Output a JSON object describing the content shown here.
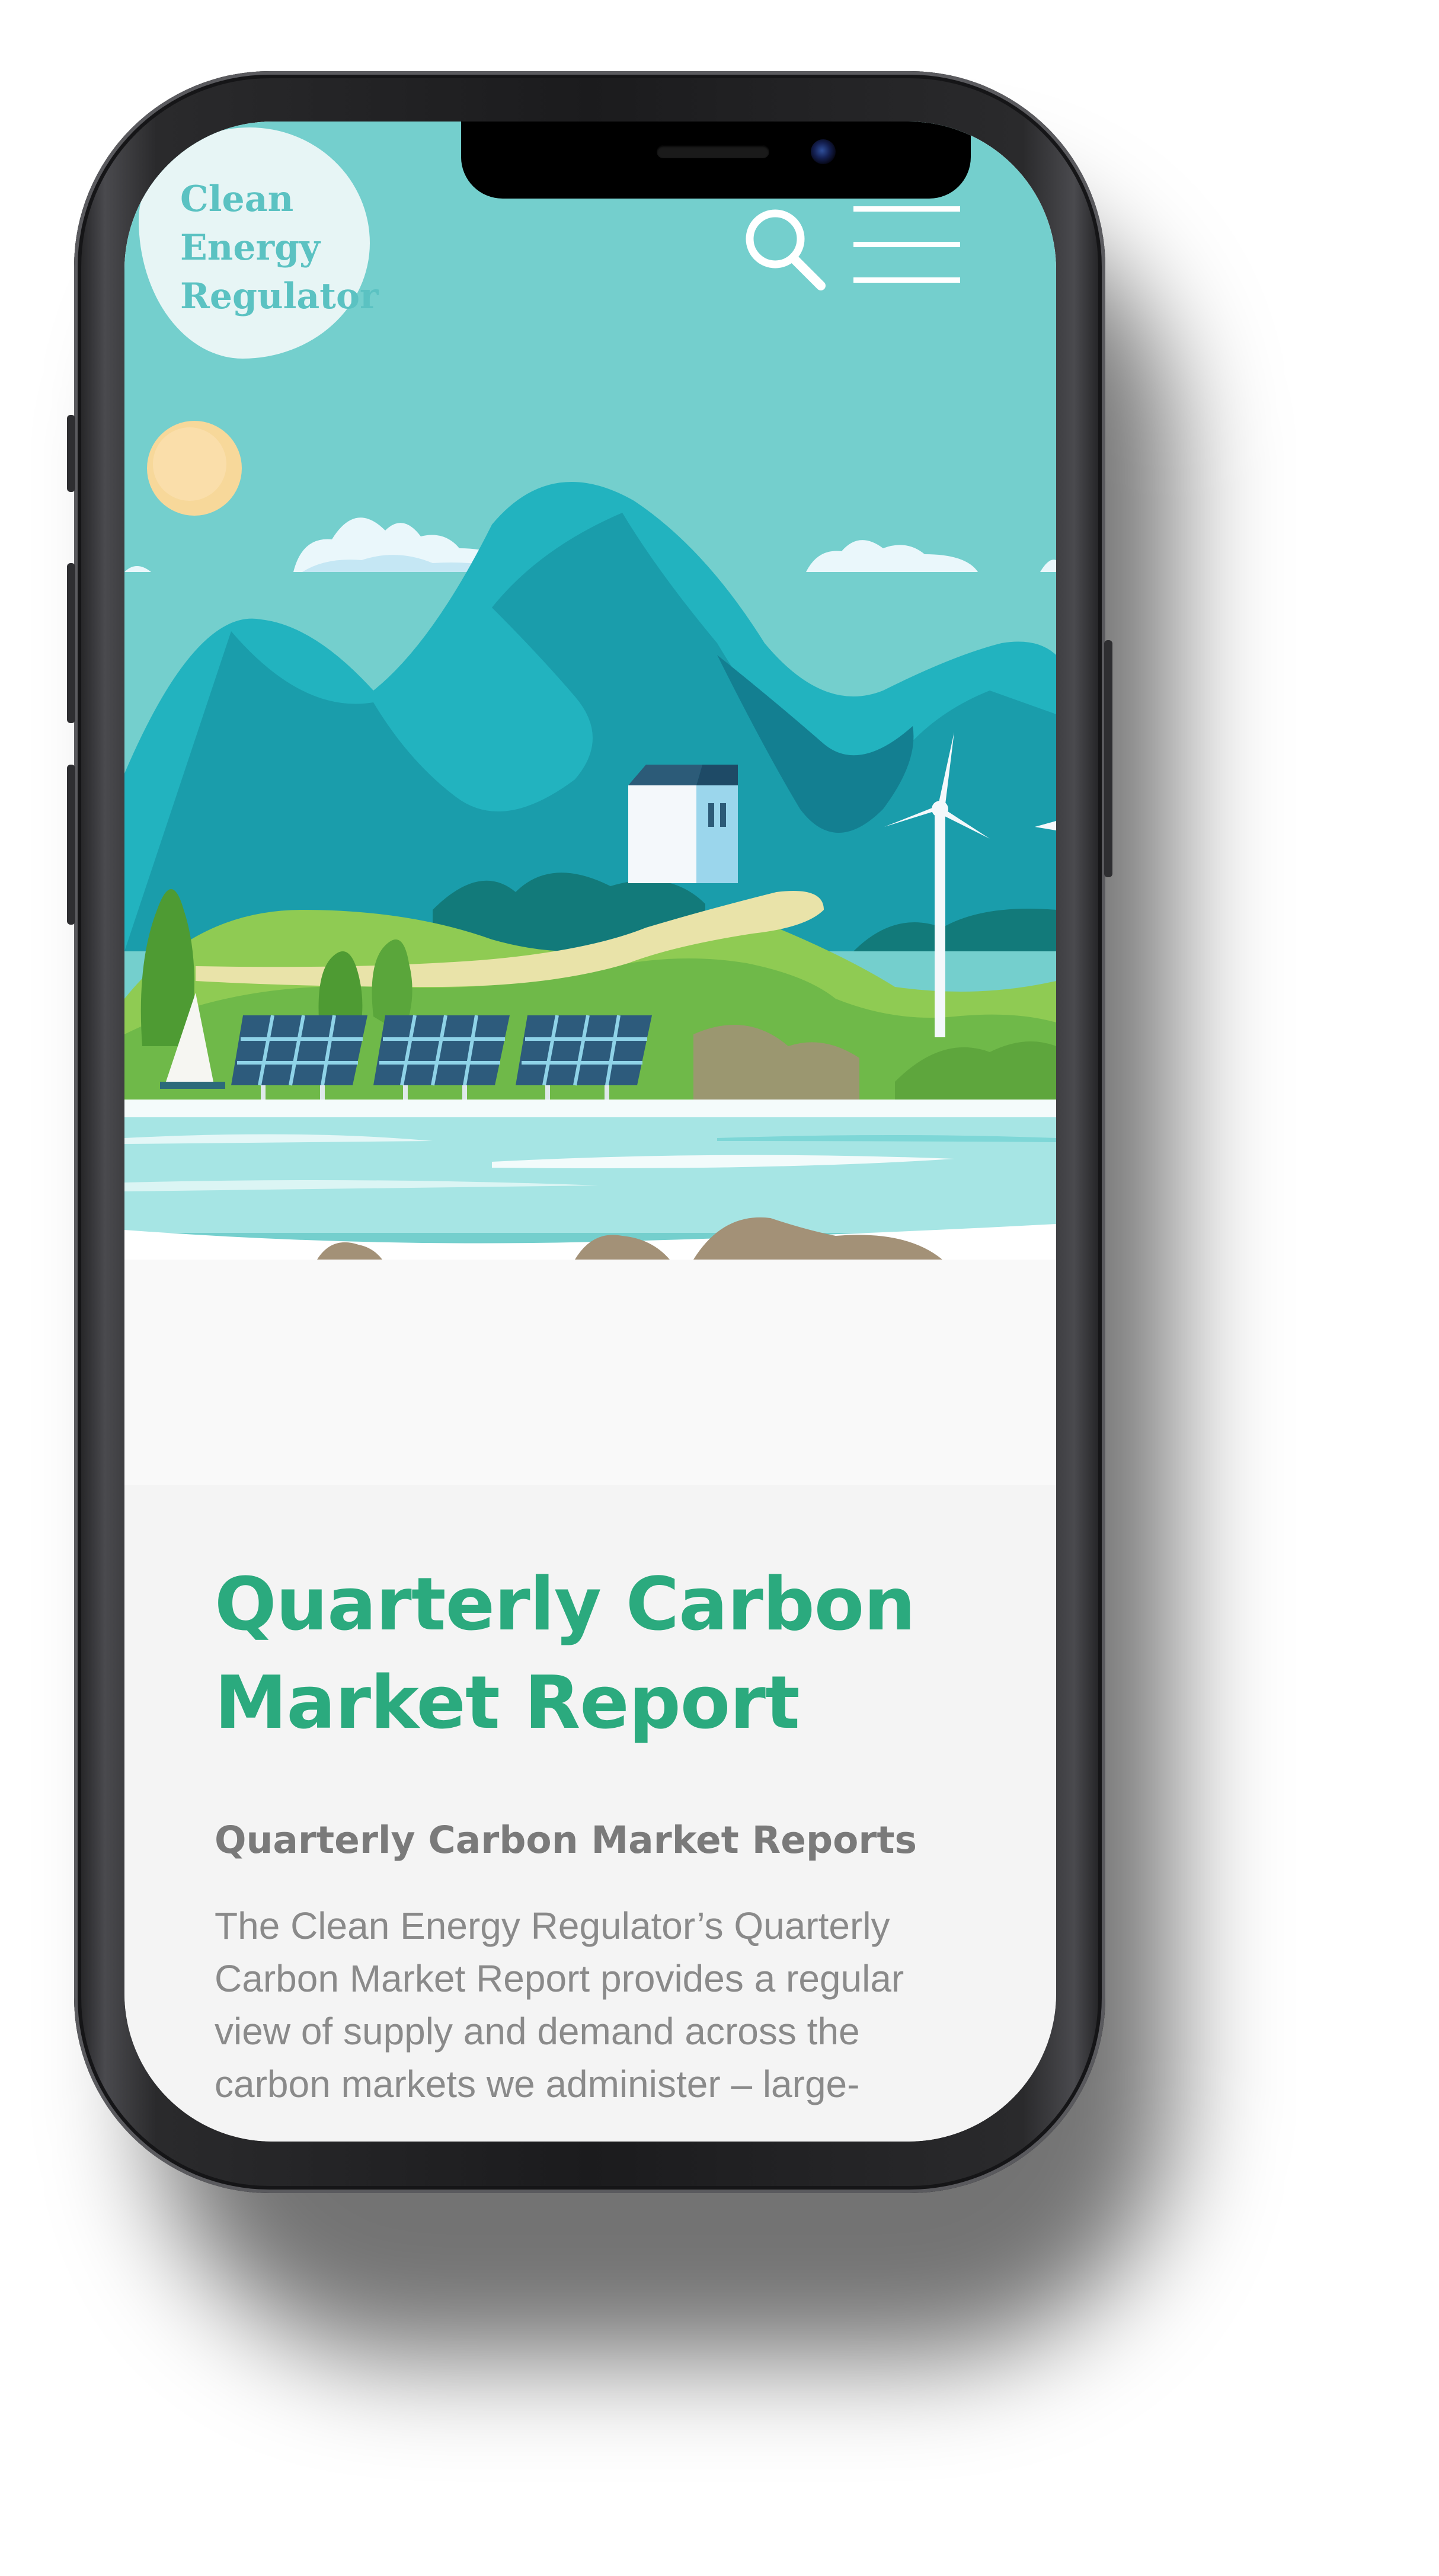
{
  "header": {
    "logo_lines": [
      "Clean",
      "Energy",
      "Regulator"
    ],
    "search_icon": "search-icon",
    "menu_icon": "hamburger-menu-icon"
  },
  "hero": {
    "illustration": "landscape-with-solar-panels-and-wind-turbine"
  },
  "page": {
    "title": "Quarterly Carbon Market Report",
    "subtitle": "Quarterly Carbon Market Reports",
    "intro": "The Clean Energy Regulator’s Quarterly Carbon Market Report provides a regular view of supply and demand across the carbon markets we administer – large-"
  },
  "colors": {
    "accent": "#2baa7e",
    "sky": "#74cfcd",
    "logo_text": "#5bc2c2",
    "body_text": "#8a8a8a"
  }
}
